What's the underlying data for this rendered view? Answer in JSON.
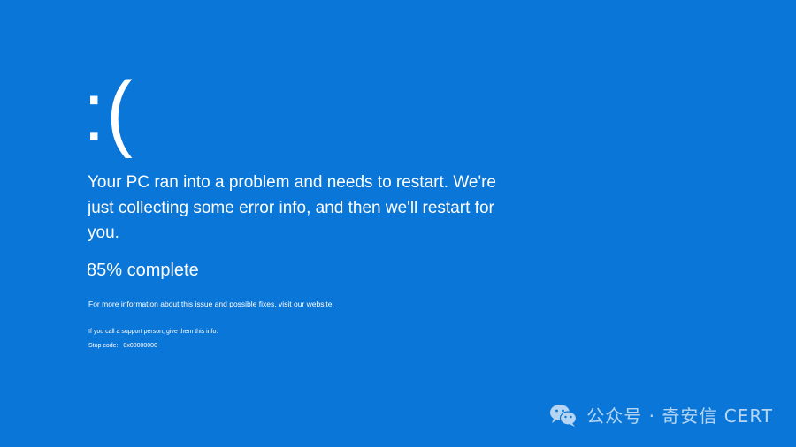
{
  "bsod": {
    "face": ":(",
    "message": "Your PC ran into a problem and needs to restart. We're just collecting some error info, and then we'll restart for you.",
    "progress_percent": 85,
    "progress_text": "85% complete",
    "more_info": "For more information about this issue and possible fixes, visit our website.",
    "support_line": "If you call a support person, give them this info:",
    "stop_code_label": "Stop code:",
    "stop_code_value": "0x00000000"
  },
  "watermark": {
    "icon": "wechat-icon",
    "text": "公众号 · 奇安信 CERT"
  },
  "colors": {
    "background": "#0a76d8",
    "text": "#ffffff"
  }
}
